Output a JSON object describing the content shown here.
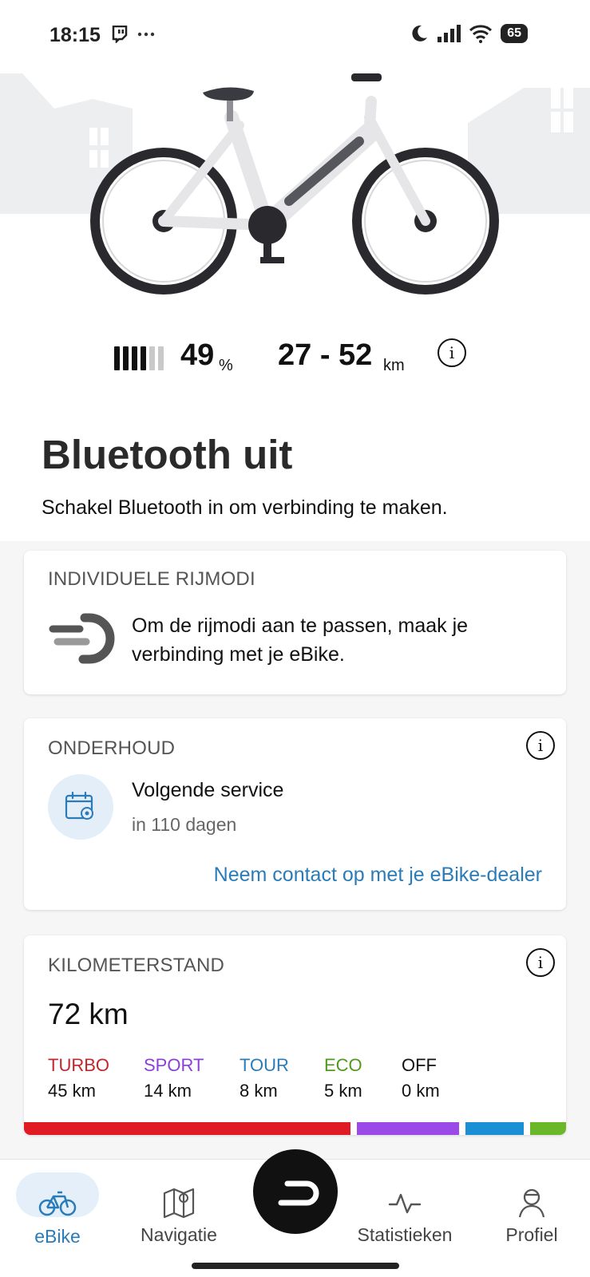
{
  "status_bar": {
    "time": "18:15",
    "left_icons": [
      "twitch-icon",
      "more-dots-icon"
    ],
    "right_icons": [
      "moon-icon",
      "signal-icon",
      "wifi-icon"
    ],
    "battery": "65"
  },
  "stats": {
    "battery_bars_filled": 4,
    "battery_bars_total": 6,
    "battery_percent": "49",
    "battery_unit": "%",
    "range": "27 - 52",
    "range_unit": "km",
    "info": "i"
  },
  "bluetooth": {
    "title": "Bluetooth uit",
    "subtitle": "Schakel Bluetooth in om verbinding te maken."
  },
  "rijmodi": {
    "label": "INDIVIDUELE RIJMODI",
    "text": "Om de rijmodi aan te passen, maak je verbinding met je eBike."
  },
  "onderhoud": {
    "label": "ONDERHOUD",
    "info": "i",
    "service_title": "Volgende service",
    "service_sub": "in 110 dagen",
    "dealer_link": "Neem contact op met je eBike-dealer"
  },
  "kilometerstand": {
    "label": "KILOMETERSTAND",
    "info": "i",
    "total": "72 km",
    "modes": [
      {
        "name": "TURBO",
        "value": "45 km",
        "km": 45,
        "color": "#e01b24"
      },
      {
        "name": "SPORT",
        "value": "14 km",
        "km": 14,
        "color": "#9a4ae6"
      },
      {
        "name": "TOUR",
        "value": "8 km",
        "km": 8,
        "color": "#1a8fd6"
      },
      {
        "name": "ECO",
        "value": "5 km",
        "km": 5,
        "color": "#6ab82a"
      },
      {
        "name": "OFF",
        "value": "0 km",
        "km": 0,
        "color": "#111111"
      }
    ]
  },
  "nav": {
    "items": [
      {
        "label": "eBike",
        "icon": "bike-icon",
        "active": true
      },
      {
        "label": "Navigatie",
        "icon": "map-icon",
        "active": false
      },
      {
        "label": "Statistieken",
        "icon": "activity-icon",
        "active": false
      },
      {
        "label": "Profiel",
        "icon": "profile-icon",
        "active": false
      }
    ],
    "center": "ride-button"
  },
  "colors": {
    "accent": "#2a7cb8",
    "active_pill": "#e4eff9"
  }
}
